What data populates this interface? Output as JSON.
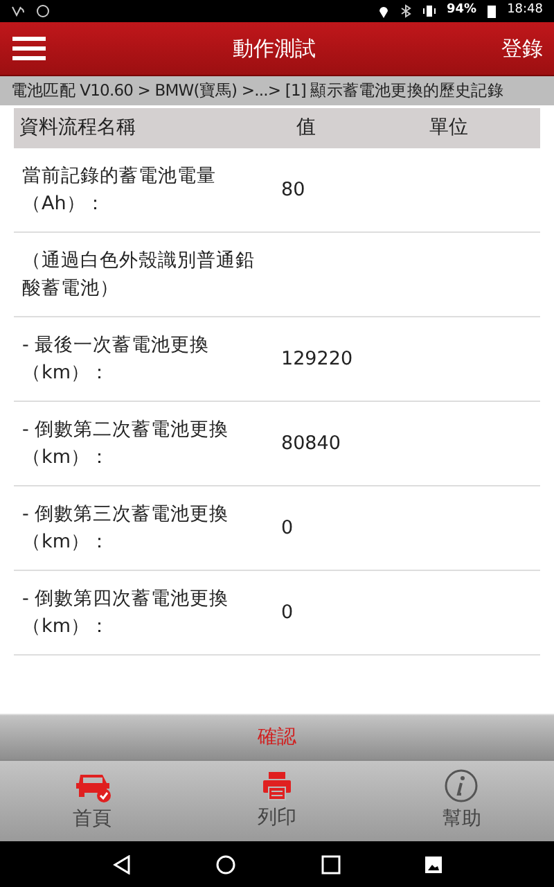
{
  "status_bar": {
    "battery": "94%",
    "time": "18:48"
  },
  "header": {
    "title": "動作測試",
    "action": "登錄"
  },
  "breadcrumb": "電池匹配 V10.60 > BMW(寶馬) >...> [1] 顯示蓄電池更換的歷史記錄",
  "table": {
    "columns": [
      "資料流程名稱",
      "值",
      "單位"
    ],
    "rows": [
      {
        "name": "當前記錄的蓄電池電量（Ah）：",
        "value": "80"
      },
      {
        "name": "（通過白色外殼識別普通鉛酸蓄電池）"
      },
      {
        "name": "- 最後一次蓄電池更換（km）：",
        "value": "129220"
      },
      {
        "name": "- 倒數第二次蓄電池更換（km）：",
        "value": "80840"
      },
      {
        "name": "- 倒數第三次蓄電池更換（km）：",
        "value": "0"
      },
      {
        "name": "- 倒數第四次蓄電池更換（km）：",
        "value": "0"
      }
    ]
  },
  "confirm_button": "確認",
  "bottom_nav": [
    {
      "kind": "car",
      "label": "首頁",
      "color": "#e02020"
    },
    {
      "kind": "printer",
      "label": "列印",
      "color": "#e02020"
    },
    {
      "kind": "info",
      "label": "幫助",
      "color": "#555555"
    }
  ]
}
